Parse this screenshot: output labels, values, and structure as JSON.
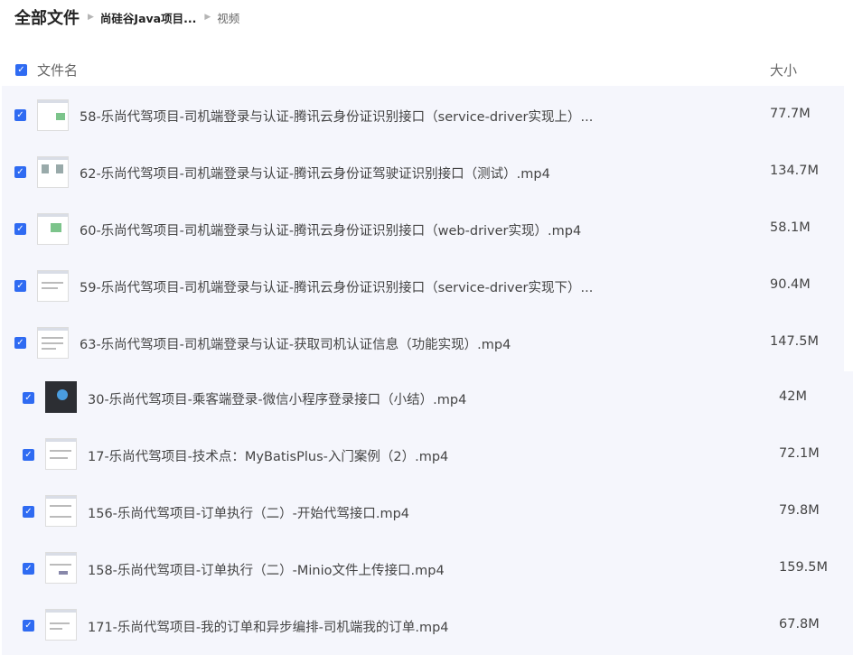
{
  "breadcrumb": {
    "root": "全部文件",
    "middle": "尚硅谷Java项目...",
    "current": "视频"
  },
  "header": {
    "name_label": "文件名",
    "size_label": "大小"
  },
  "files": [
    {
      "name": "58-乐尚代驾项目-司机端登录与认证-腾讯云身份证识别接口（service-driver实现上）...",
      "size": "77.7M"
    },
    {
      "name": "62-乐尚代驾项目-司机端登录与认证-腾讯云身份证驾驶证识别接口（测试）.mp4",
      "size": "134.7M"
    },
    {
      "name": "60-乐尚代驾项目-司机端登录与认证-腾讯云身份证识别接口（web-driver实现）.mp4",
      "size": "58.1M"
    },
    {
      "name": "59-乐尚代驾项目-司机端登录与认证-腾讯云身份证识别接口（service-driver实现下）...",
      "size": "90.4M"
    },
    {
      "name": "63-乐尚代驾项目-司机端登录与认证-获取司机认证信息（功能实现）.mp4",
      "size": "147.5M"
    },
    {
      "name": "30-乐尚代驾项目-乘客端登录-微信小程序登录接口（小结）.mp4",
      "size": "42M"
    },
    {
      "name": "17-乐尚代驾项目-技术点：MyBatisPlus-入门案例（2）.mp4",
      "size": "72.1M"
    },
    {
      "name": "156-乐尚代驾项目-订单执行（二）-开始代驾接口.mp4",
      "size": "79.8M"
    },
    {
      "name": "158-乐尚代驾项目-订单执行（二）-Minio文件上传接口.mp4",
      "size": "159.5M"
    },
    {
      "name": "171-乐尚代驾项目-我的订单和异步编排-司机端我的订单.mp4",
      "size": "67.8M"
    }
  ],
  "colors": {
    "accent": "#2f6bf2",
    "selected_bg": "#f5f6fc"
  }
}
